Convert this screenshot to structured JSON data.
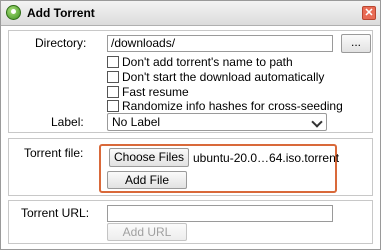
{
  "dialog": {
    "title": "Add Torrent",
    "close_glyph": "✕"
  },
  "options": {
    "directory_label": "Directory:",
    "directory_value": "/downloads/",
    "browse_label": "...",
    "checkboxes": [
      {
        "label": "Don't add torrent's name to path",
        "checked": false
      },
      {
        "label": "Don't start the download automatically",
        "checked": false
      },
      {
        "label": "Fast resume",
        "checked": false
      },
      {
        "label": "Randomize info hashes for cross-seeding",
        "checked": false
      }
    ],
    "label_label": "Label:",
    "label_value": "No Label"
  },
  "torrent_file": {
    "label": "Torrent file:",
    "choose_label": "Choose Files",
    "file_name": "ubuntu-20.0…64.iso.torrent",
    "add_label": "Add File"
  },
  "torrent_url": {
    "label": "Torrent URL:",
    "value": "",
    "add_label": "Add URL"
  },
  "colors": {
    "highlight": "#d9693a",
    "accent": "#3d8f1e"
  }
}
